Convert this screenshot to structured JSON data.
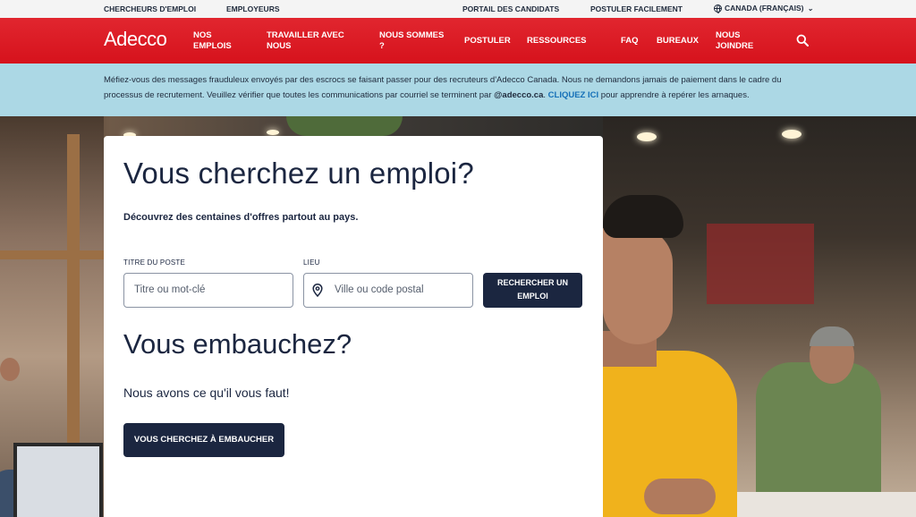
{
  "topbar": {
    "job_seekers": "CHERCHEURS D'EMPLOI",
    "employers": "EMPLOYEURS",
    "candidate_portal": "PORTAIL DES CANDIDATS",
    "easy_apply": "POSTULER FACILEMENT",
    "country": "CANADA (FRANÇAIS)"
  },
  "nav": {
    "logo": "Adecco",
    "items": [
      {
        "label": "NOS EMPLOIS"
      },
      {
        "label": "TRAVAILLER AVEC NOUS"
      },
      {
        "label": "NOUS SOMMES ?"
      },
      {
        "label": "POSTULER"
      },
      {
        "label": "RESSOURCES"
      },
      {
        "label": "FAQ"
      },
      {
        "label": "BUREAUX"
      },
      {
        "label": "NOUS JOINDRE"
      }
    ]
  },
  "alert": {
    "text_1": "Méfiez-vous des messages frauduleux envoyés par des escrocs se faisant passer pour des recruteurs d'Adecco Canada. Nous ne demandons jamais de paiement dans le cadre du processus de recrutement. Veuillez vérifier que toutes les communications par courriel se terminent par ",
    "domain": "@adecco.ca",
    "text_2": ". ",
    "link": "CLIQUEZ ICI",
    "text_3": " pour apprendre à repérer les arnaques."
  },
  "card": {
    "title": "Vous cherchez un emploi?",
    "subtitle": "Découvrez des centaines d'offres partout au pays.",
    "job_title_label": "TITRE DU POSTE",
    "job_title_placeholder": "Titre ou mot-clé",
    "location_label": "LIEU",
    "location_placeholder": "Ville ou code postal",
    "search_button": "RECHERCHER UN EMPLOI",
    "hiring_title": "Vous embauchez?",
    "hiring_text": "Nous avons ce qu'il vous faut!",
    "hiring_button": "VOUS CHERCHEZ À EMBAUCHER"
  },
  "icons": {
    "globe": "globe-icon",
    "search": "search-icon",
    "location": "location-pin-icon"
  },
  "colors": {
    "brand_red": "#d6121c",
    "navy": "#1b2640",
    "alert_bg": "#acd8e5",
    "link_blue": "#1570b8"
  }
}
